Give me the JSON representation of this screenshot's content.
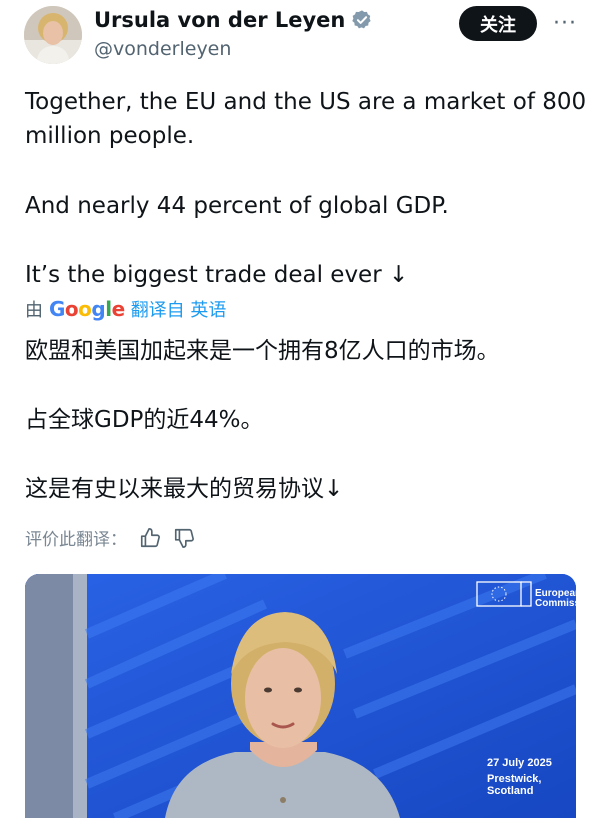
{
  "header": {
    "display_name": "Ursula von der Leyen",
    "handle": "@vonderleyen",
    "follow_label": "关注",
    "more_label": "···",
    "verified_color": "#829aab"
  },
  "tweet": {
    "paragraphs": [
      "Together, the EU and the US are a market of 800\nmillion people.",
      "And nearly 44 percent of global GDP.",
      "It’s the biggest trade deal ever ↓"
    ]
  },
  "translation": {
    "by_label": "由",
    "provider": "Google",
    "provider_letters": [
      "G",
      "o",
      "o",
      "g",
      "l",
      "e"
    ],
    "link_label": "翻译自 英语",
    "paragraphs": [
      "欧盟和美国加起来是一个拥有8亿人口的市场。",
      "占全球GDP的近44%。",
      "这是有史以来最大的贸易协议↓"
    ],
    "rate_label": "评价此翻译："
  },
  "media": {
    "logo_line1": "European",
    "logo_line2": "Commission",
    "date_text": "27 July 2025",
    "location_text": "Prestwick, Scotland"
  },
  "icons": {
    "thumbs_up": "thumbs-up-icon",
    "thumbs_down": "thumbs-down-icon",
    "verified": "verified-badge-icon",
    "more": "more-icon"
  }
}
